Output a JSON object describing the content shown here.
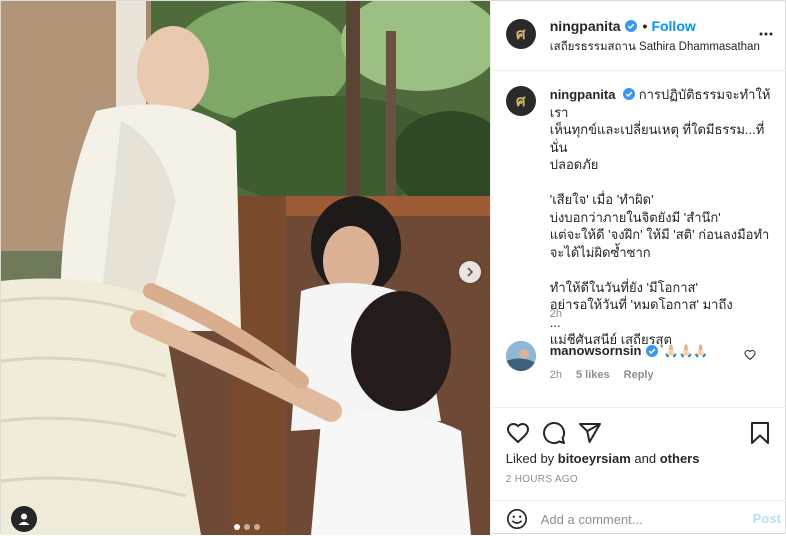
{
  "header": {
    "username": "ningpanita",
    "follow_label": "Follow",
    "separator": "•",
    "location": "เสถียรธรรมสถาน Sathira Dhammasathan"
  },
  "caption": {
    "username": "ningpanita",
    "lines": [
      "การปฏิบัติธรรมจะทำให้เรา",
      "เห็นทุกข์และเปลี่ยนเหตุ ที่ใดมีธรรม...ที่นั่น",
      "ปลอดภัย",
      "",
      "'เสียใจ' เมื่อ 'ทำผิด'",
      "บ่งบอกว่าภายในจิตยังมี 'สำนึก'",
      "แต่จะให้ดี 'จงฝึก' ให้มี 'สติ' ก่อนลงมือทำ",
      "จะได้ไม่ผิดซ้ำซาก",
      "",
      "ทำให้ดีในวันที่ยัง 'มีโอกาส'",
      "อย่ารอให้วันที่ 'หมดโอกาส' มาถึง",
      "...",
      "แม่ชีศันสนีย์ เสถียรสุต"
    ],
    "time": "2h"
  },
  "comment": {
    "username": "manowsornsin",
    "text": "🙏🏻🙏🏻🙏🏻",
    "time": "2h",
    "likes": "5 likes",
    "reply_label": "Reply"
  },
  "likes_line": {
    "prefix": "Liked by",
    "user": "bitoeyrsiam",
    "middle": "and",
    "suffix": "others"
  },
  "timestamp": "2 HOURS AGO",
  "add_comment": {
    "placeholder": "Add a comment...",
    "post_label": "Post"
  },
  "carousel": {
    "count": 3,
    "active": 1
  },
  "colors": {
    "accent": "#0095f6",
    "post_disabled": "#b2dffc",
    "verified": "#3897f0",
    "muted": "#8e8e8e"
  },
  "icons": [
    "next-arrow-icon",
    "user-tag-icon",
    "verified-icon",
    "more-options-icon",
    "heart-icon",
    "comment-icon",
    "share-icon",
    "bookmark-icon",
    "emoji-icon"
  ]
}
